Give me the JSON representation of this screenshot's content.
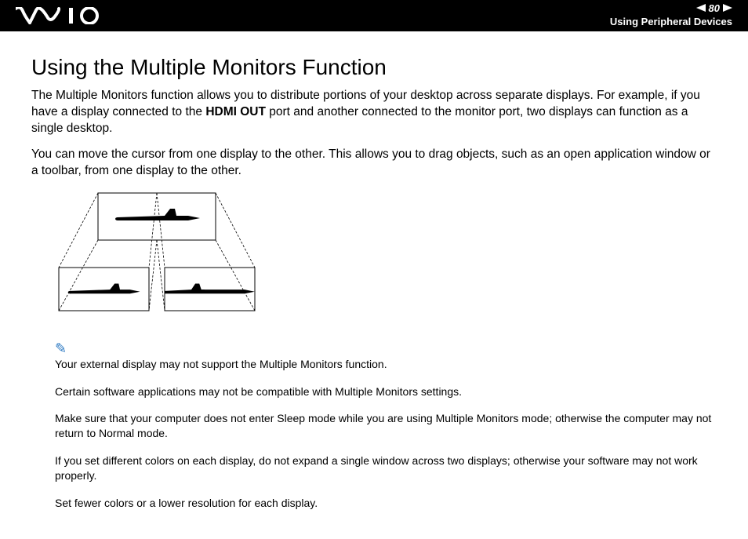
{
  "header": {
    "logo_alt": "VAIO",
    "page_number": "80",
    "section": "Using Peripheral Devices"
  },
  "title": "Using the Multiple Monitors Function",
  "para1_a": "The Multiple Monitors function allows you to distribute portions of your desktop across separate displays. For example, if you have a display connected to the ",
  "para1_bold": "HDMI OUT",
  "para1_b": " port and another connected to the monitor port, two displays can function as a single desktop.",
  "para2": "You can move the cursor from one display to the other. This allows you to drag objects, such as an open application window or a toolbar, from one display to the other.",
  "notes": {
    "n1": "Your external display may not support the Multiple Monitors function.",
    "n2": "Certain software applications may not be compatible with Multiple Monitors settings.",
    "n3": "Make sure that your computer does not enter Sleep mode while you are using Multiple Monitors mode; otherwise the computer may not return to Normal mode.",
    "n4": "If you set different colors on each display, do not expand a single window across two displays; otherwise your software may not work properly.",
    "n5": "Set fewer colors or a lower resolution for each display."
  }
}
